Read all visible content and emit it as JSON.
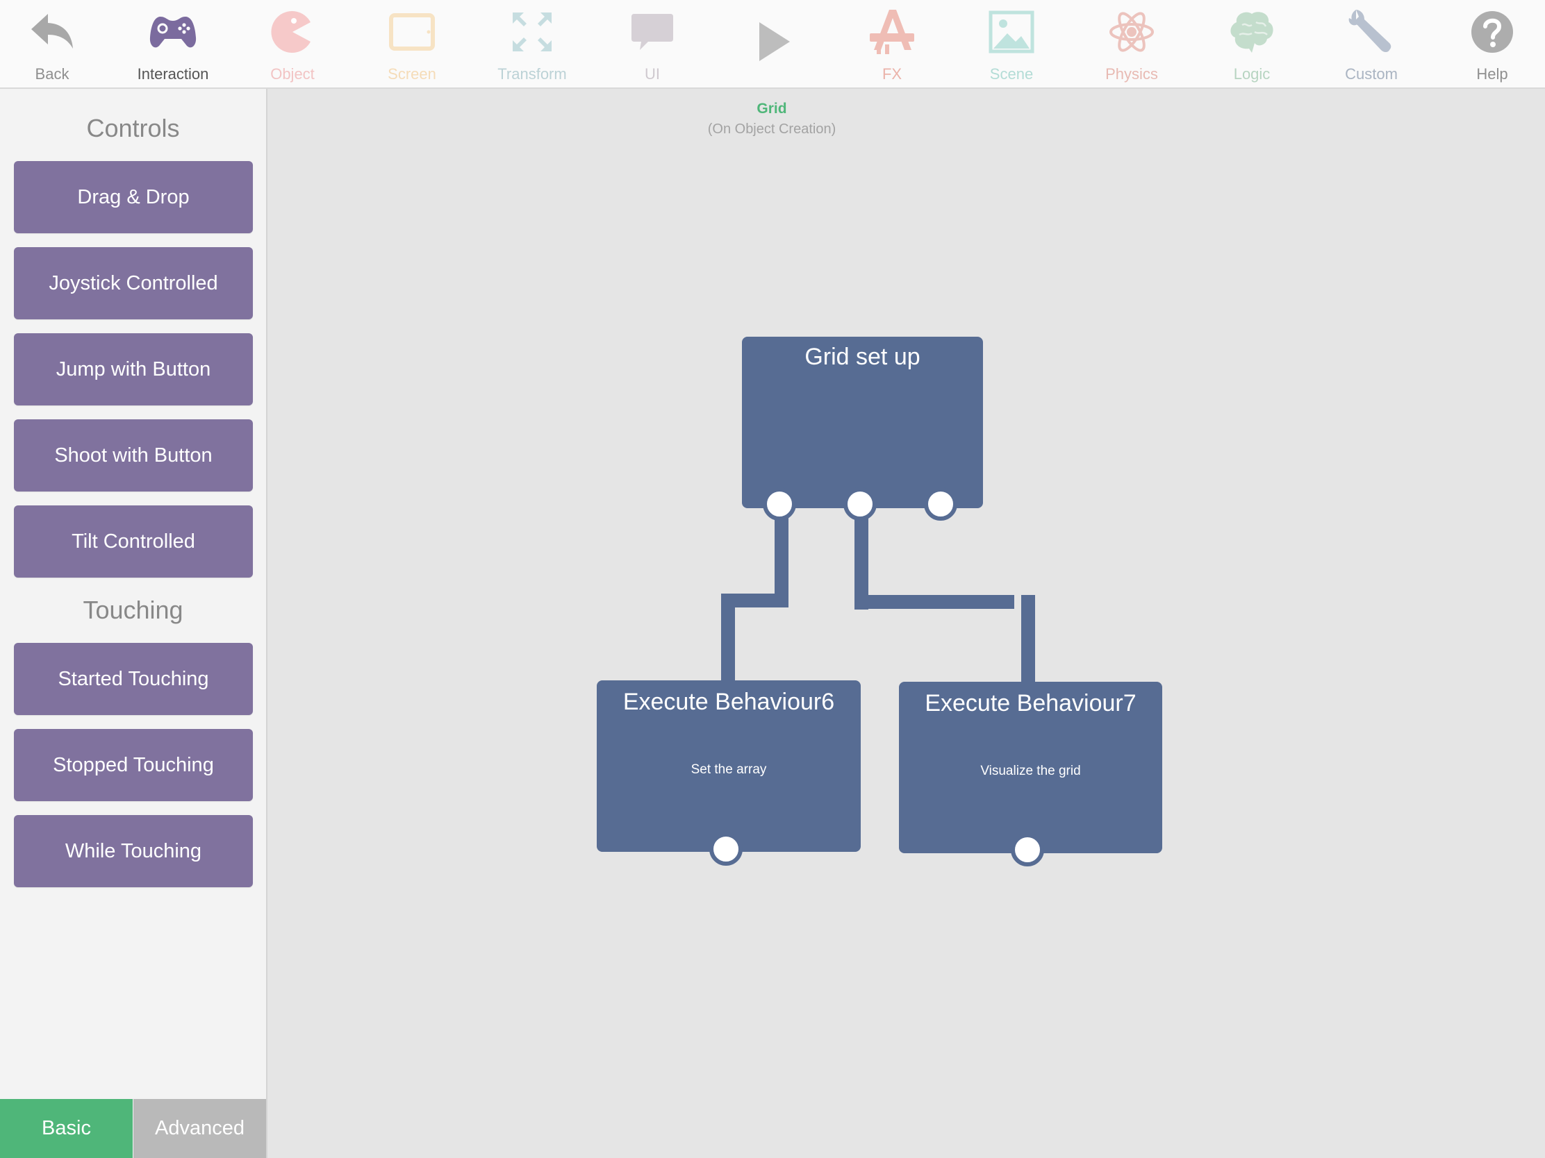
{
  "toolbar": {
    "back": {
      "label": "Back",
      "color": "#a8a8a8"
    },
    "interaction": {
      "label": "Interaction",
      "color": "#7b6b9e",
      "active": true
    },
    "object": {
      "label": "Object",
      "color": "#f6c9c9"
    },
    "screen": {
      "label": "Screen",
      "color": "#f7e3c4"
    },
    "transform": {
      "label": "Transform",
      "color": "#c6dde0"
    },
    "ui": {
      "label": "UI",
      "color": "#d6d0d6"
    },
    "play": {
      "color": "#bdbdbd"
    },
    "fx": {
      "label": "FX",
      "color": "#efbdb5"
    },
    "scene": {
      "label": "Scene",
      "color": "#bfe3de"
    },
    "physics": {
      "label": "Physics",
      "color": "#ecc3bd"
    },
    "logic": {
      "label": "Logic",
      "color": "#c4ddcc"
    },
    "custom": {
      "label": "Custom",
      "color": "#b8c1cf"
    },
    "help": {
      "label": "Help",
      "color": "#adadad"
    }
  },
  "sidebar": {
    "controls_title": "Controls",
    "controls": [
      "Drag & Drop",
      "Joystick Controlled",
      "Jump with Button",
      "Shoot with Button",
      "Tilt Controlled"
    ],
    "touching_title": "Touching",
    "touching": [
      "Started Touching",
      "Stopped Touching",
      "While Touching"
    ],
    "basic_label": "Basic",
    "advanced_label": "Advanced",
    "basic_color": "#4fb679",
    "advanced_color": "#b9b9b9",
    "button_color": "#80729e"
  },
  "canvas": {
    "object_name": "Grid",
    "event": "(On Object Creation)",
    "nodes": {
      "root": {
        "title": "Grid set up",
        "subtitle": ""
      },
      "left": {
        "title": "Execute Behaviour6",
        "subtitle": "Set the array"
      },
      "right": {
        "title": "Execute Behaviour7",
        "subtitle": "Visualize the grid"
      }
    },
    "node_color": "#576c93"
  }
}
